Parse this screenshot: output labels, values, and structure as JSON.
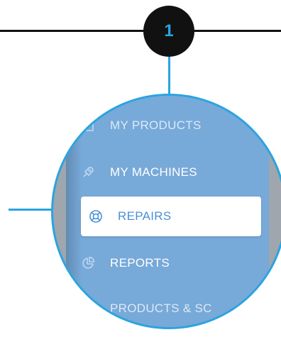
{
  "callout": {
    "number": "1"
  },
  "menu": {
    "items": [
      {
        "label": "MY PRODUCTS",
        "icon": "box-icon",
        "active": false
      },
      {
        "label": "MY MACHINES",
        "icon": "rocket-icon",
        "active": false
      },
      {
        "label": "REPAIRS",
        "icon": "lifebuoy-icon",
        "active": true
      },
      {
        "label": "REPORTS",
        "icon": "pie-chart-icon",
        "active": false
      },
      {
        "label": "PRODUCTS & SC",
        "icon": "box-icon",
        "active": false
      }
    ]
  },
  "colors": {
    "accent": "#2aa4e0",
    "panel": "#77a9d9",
    "active_text": "#4a90d6",
    "line": "#111111"
  }
}
